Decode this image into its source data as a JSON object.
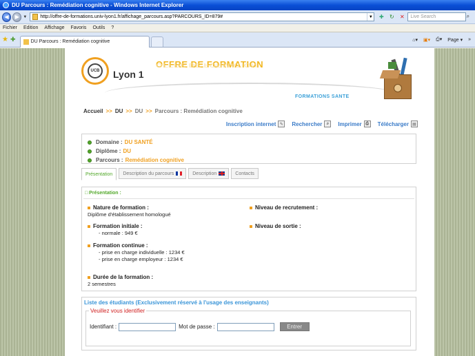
{
  "window": {
    "title": "DU Parcours : Remédiation cognitive - Windows Internet Explorer"
  },
  "addressbar": {
    "url": "http://offre-de-formations.univ-lyon1.fr/affichage_parcours.asp?PARCOURS_ID=879#",
    "search_placeholder": "Live Search"
  },
  "menu": {
    "items": [
      "Fichier",
      "Edition",
      "Affichage",
      "Favoris",
      "Outils",
      "?"
    ]
  },
  "browser_tabs": {
    "active_label": "DU Parcours : Remédiation cognitive",
    "page_label": "Page",
    "page_arrow": "▾",
    "tools_arrow": "»"
  },
  "banner": {
    "logo_text": "Lyon 1",
    "logo_inner": "UCB",
    "heading": "OFFRE DE FORMATION",
    "subheading": "FORMATIONS SANTE"
  },
  "breadcrumb": {
    "home": "Accueil",
    "sep": ">>",
    "level1": "DU",
    "level2": "DU",
    "current": "Parcours : Remédiation cognitive"
  },
  "actions": {
    "inscription": "Inscription internet",
    "recherche": "Rechercher",
    "imprimer": "Imprimer",
    "telecharger": "Télécharger"
  },
  "summary": {
    "domaine_label": "Domaine :",
    "domaine_value": "DU SANTÉ",
    "diplome_label": "Diplôme :",
    "diplome_value": "DU",
    "parcours_label": "Parcours :",
    "parcours_value": "Remédiation cognitive"
  },
  "page_tabs": {
    "presentation": "Présentation",
    "description_fr": "Description du parcours",
    "description_en": "Description",
    "contacts": "Contacts"
  },
  "presentation": {
    "section_title": "□ Présentation :",
    "nature_label": "Nature de formation :",
    "nature_value": "Diplôme d'établissement homologué",
    "niveau_rec_label": "Niveau de recrutement :",
    "formation_initiale_label": "Formation initiale :",
    "formation_initiale_value": "- normale : 949 €",
    "niveau_sortie_label": "Niveau de sortie :",
    "formation_continue_label": "Formation continue :",
    "fc_individuelle": "- prise en charge individuelle : 1234 €",
    "fc_employeur": "- prise en charge employeur : 1234 €",
    "duree_label": "Durée de la formation :",
    "duree_value": "2 semestres"
  },
  "students": {
    "title": "Liste des étudiants (Exclusivement réservé à l'usage des enseignants)",
    "legend": "Veuillez vous identifier",
    "identifiant_label": "Identifiant :",
    "password_label": "Mot de passe :",
    "submit_label": "Entrer"
  }
}
